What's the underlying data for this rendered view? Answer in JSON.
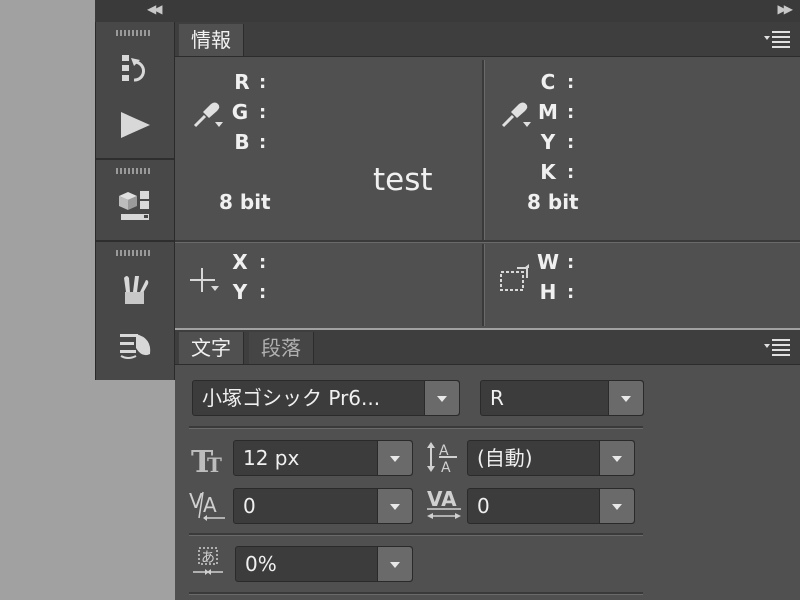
{
  "info_panel": {
    "tab_label": "情報",
    "rgb_labels": [
      "R",
      "G",
      "B"
    ],
    "cmyk_labels": [
      "C",
      "M",
      "Y",
      "K"
    ],
    "colon": ":",
    "bit_depth_left": "8 bit",
    "bit_depth_right": "8 bit",
    "sample_text": "test",
    "xy_labels": [
      "X",
      "Y"
    ],
    "wh_labels": [
      "W",
      "H"
    ]
  },
  "char_panel": {
    "tabs": [
      "文字",
      "段落"
    ],
    "font_family": "小塚ゴシック Pr6...",
    "font_style": "R",
    "font_size": "12 px",
    "leading": "(自動)",
    "kerning": "0",
    "tracking": "0",
    "tsume": "0%"
  },
  "colors": {
    "panel_bg": "#505050",
    "tab_bar_bg": "#3e3e3e",
    "field_bg": "#3c3c3c",
    "dropdown_button": "#6a6a6a",
    "desktop_bg": "#a1a1a1"
  }
}
